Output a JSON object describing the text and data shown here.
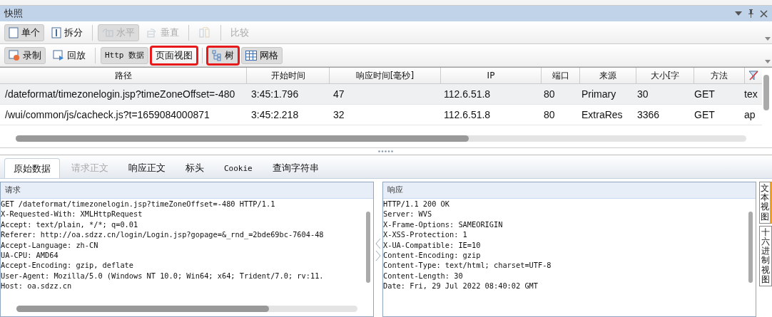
{
  "window": {
    "title": "快照"
  },
  "toolbar_1": [
    {
      "kind": "single",
      "label": "单个",
      "selected": true,
      "disabled": false
    },
    {
      "kind": "split",
      "label": "拆分",
      "selected": false,
      "disabled": false
    },
    {
      "kind": "horizontal",
      "label": "水平",
      "selected": true,
      "disabled": true
    },
    {
      "kind": "vertical",
      "label": "垂直",
      "selected": false,
      "disabled": true
    },
    {
      "kind": "swap",
      "selected": false,
      "disabled": true
    },
    {
      "kind": "text",
      "label": "比较",
      "selected": false,
      "disabled": true
    }
  ],
  "toolbar_2": [
    {
      "kind": "record",
      "label": "录制",
      "selected": true,
      "highlighted": false
    },
    {
      "kind": "replay",
      "label": "回放",
      "selected": false,
      "highlighted": false
    },
    {
      "kind": "mono",
      "label": "Http 数据",
      "selected": true,
      "highlighted": false
    },
    {
      "kind": "text",
      "label": "页面视图",
      "selected": false,
      "highlighted": true
    },
    {
      "kind": "tree",
      "label": "树",
      "selected": true,
      "highlighted": true
    },
    {
      "kind": "grid",
      "label": "网格",
      "selected": true,
      "highlighted": false
    }
  ],
  "table": {
    "columns": [
      "路径",
      "开始时间",
      "响应时间[毫秒]",
      "IP",
      "端口",
      "来源",
      "大小[字",
      "方法"
    ],
    "rows": [
      {
        "selected": true,
        "cells": [
          "/dateformat/timezonelogin.jsp?timeZoneOffset=-480",
          "3:45:1.796",
          "47",
          "112.6.51.8",
          "80",
          "Primary",
          "30",
          "GET",
          "tex"
        ]
      },
      {
        "selected": false,
        "cells": [
          "/wui/common/js/cacheck.js?t=1659084000871",
          "3:45:2.218",
          "32",
          "112.6.51.8",
          "80",
          "ExtraRes",
          "3366",
          "GET",
          "ap"
        ]
      }
    ]
  },
  "detail_tabs": [
    {
      "label": "原始数据",
      "selected": true,
      "disabled": false
    },
    {
      "label": "请求正文",
      "selected": false,
      "disabled": true
    },
    {
      "label": "响应正文",
      "selected": false,
      "disabled": false
    },
    {
      "label": "标头",
      "selected": false,
      "disabled": false
    },
    {
      "label": "Cookie",
      "selected": false,
      "disabled": false
    },
    {
      "label": "查询字符串",
      "selected": false,
      "disabled": false
    }
  ],
  "request": {
    "title": "请求",
    "lines": [
      "GET /dateformat/timezonelogin.jsp?timeZoneOffset=-480 HTTP/1.1",
      "X-Requested-With: XMLHttpRequest",
      "Accept: text/plain, */*; q=0.01",
      "Referer: http://oa.sdzz.cn/login/Login.jsp?gopage=&_rnd_=2bde69bc-7604-48",
      "Accept-Language: zh-CN",
      "UA-CPU: AMD64",
      "Accept-Encoding: gzip, deflate",
      "User-Agent: Mozilla/5.0 (Windows NT 10.0; Win64; x64; Trident/7.0; rv:11.",
      "Host: oa.sdzz.cn"
    ]
  },
  "response": {
    "title": "响应",
    "lines": [
      "HTTP/1.1 200 OK",
      "Server: WVS",
      "X-Frame-Options: SAMEORIGIN",
      "X-XSS-Protection: 1",
      "X-UA-Compatible: IE=10",
      "Content-Encoding: gzip",
      "Content-Type: text/html; charset=UTF-8",
      "Content-Length: 30",
      "Date: Fri, 29 Jul 2022 08:40:02 GMT"
    ]
  },
  "side_tabs": [
    {
      "label": "文本视图",
      "selected": true
    },
    {
      "label": "十六进制视图",
      "selected": false
    }
  ]
}
